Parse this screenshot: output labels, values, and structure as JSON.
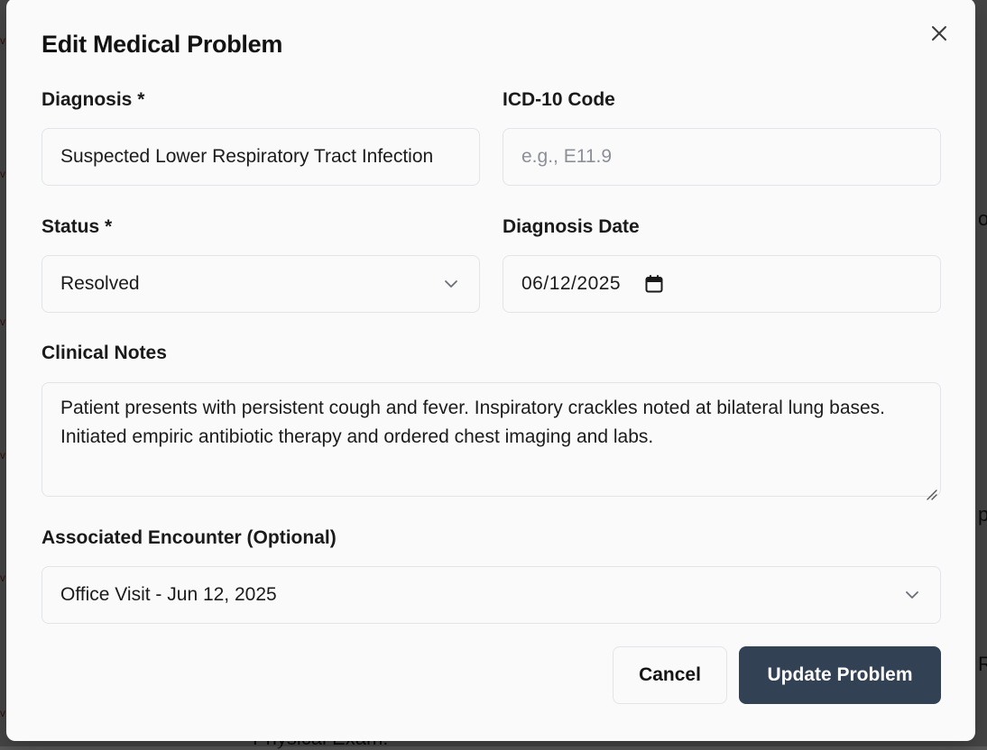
{
  "background": {
    "fragments": [
      "on",
      "pa",
      "R",
      "Physical Exam:"
    ]
  },
  "dialog": {
    "title": "Edit Medical Problem",
    "close_icon": "close-icon"
  },
  "form": {
    "diagnosis": {
      "label": "Diagnosis *",
      "value": "Suspected Lower Respiratory Tract Infection"
    },
    "icd10": {
      "label": "ICD-10 Code",
      "placeholder": "e.g., E11.9",
      "value": ""
    },
    "status": {
      "label": "Status *",
      "value": "Resolved"
    },
    "diagnosis_date": {
      "label": "Diagnosis Date",
      "value": "06/12/2025"
    },
    "clinical_notes": {
      "label": "Clinical Notes",
      "value": "Patient presents with persistent cough and fever. Inspiratory crackles noted at bilateral lung bases. Initiated empiric antibiotic therapy and ordered chest imaging and labs."
    },
    "encounter": {
      "label": "Associated Encounter (Optional)",
      "value": "Office Visit - Jun 12, 2025"
    }
  },
  "actions": {
    "cancel_label": "Cancel",
    "submit_label": "Update Problem"
  },
  "colors": {
    "primary_button": "#334155",
    "border": "#e2e4e8",
    "placeholder": "#8b8f98"
  }
}
